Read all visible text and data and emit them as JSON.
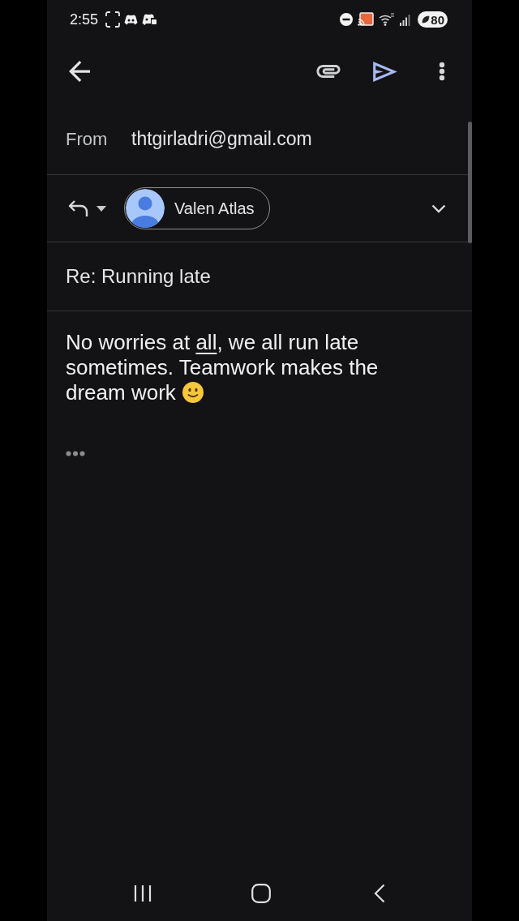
{
  "status_bar": {
    "time": "2:55",
    "battery": "80"
  },
  "from": {
    "label": "From",
    "address": "thtgirladri@gmail.com"
  },
  "recipients": [
    {
      "name": "Valen Atlas"
    }
  ],
  "subject": "Re: Running late",
  "body": {
    "segments": [
      {
        "text": "No worries at ",
        "underlined": false
      },
      {
        "text": "all",
        "underlined": true
      },
      {
        "text": ", we all run late sometimes. Teamwork makes the dream work",
        "underlined": false
      }
    ]
  }
}
